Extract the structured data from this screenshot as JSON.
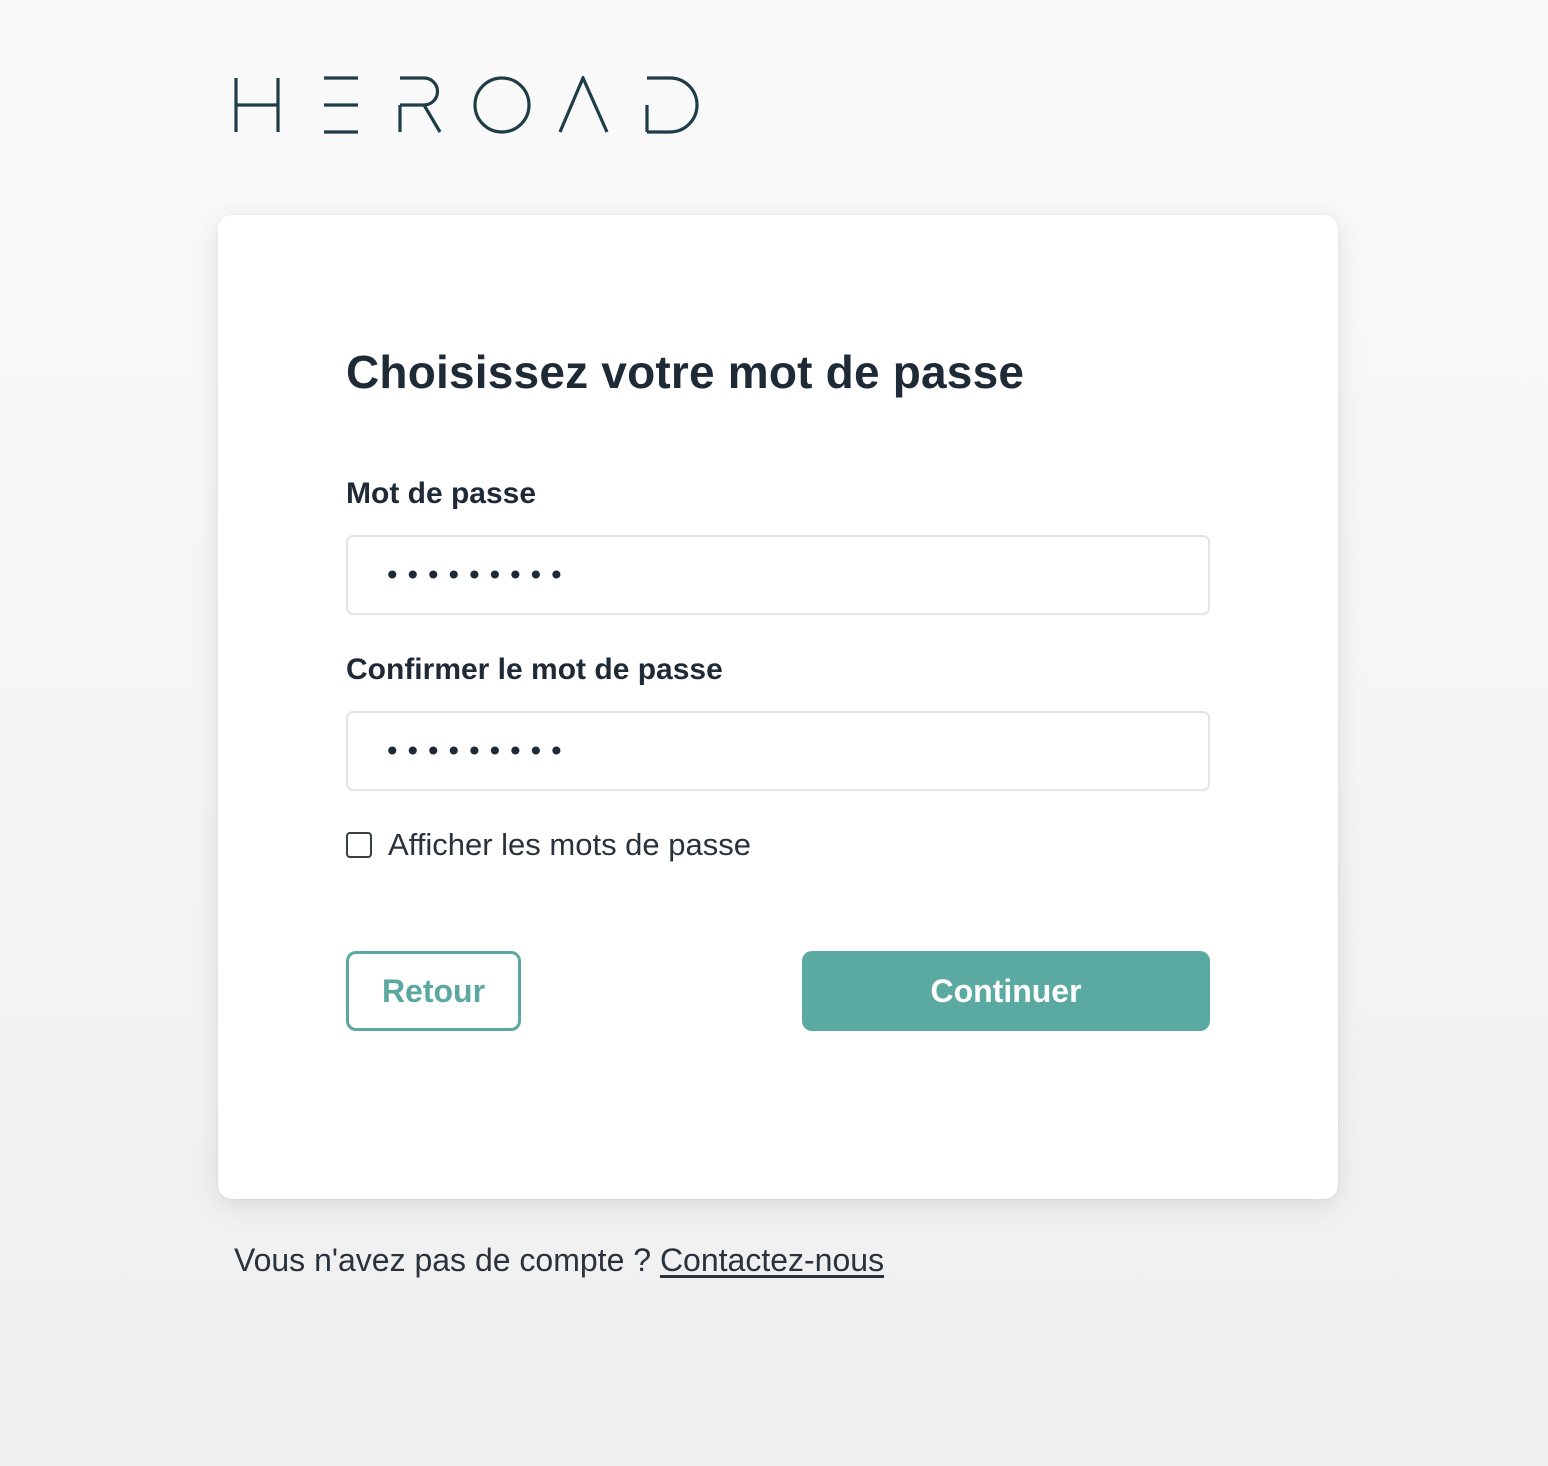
{
  "brand": {
    "logo_text": "HEROAD",
    "logo_color": "#1e3d47"
  },
  "form": {
    "title": "Choisissez votre mot de passe",
    "password_label": "Mot de passe",
    "password_value": "•••••••••",
    "confirm_label": "Confirmer le mot de passe",
    "confirm_value": "•••••••••",
    "show_passwords_label": "Afficher les mots de passe",
    "show_passwords_checked": false,
    "back_label": "Retour",
    "continue_label": "Continuer"
  },
  "footer": {
    "prompt": "Vous n'avez pas de compte ? ",
    "contact_link": "Contactez-nous"
  },
  "colors": {
    "accent": "#5aaaa2",
    "text": "#1f2a37"
  }
}
